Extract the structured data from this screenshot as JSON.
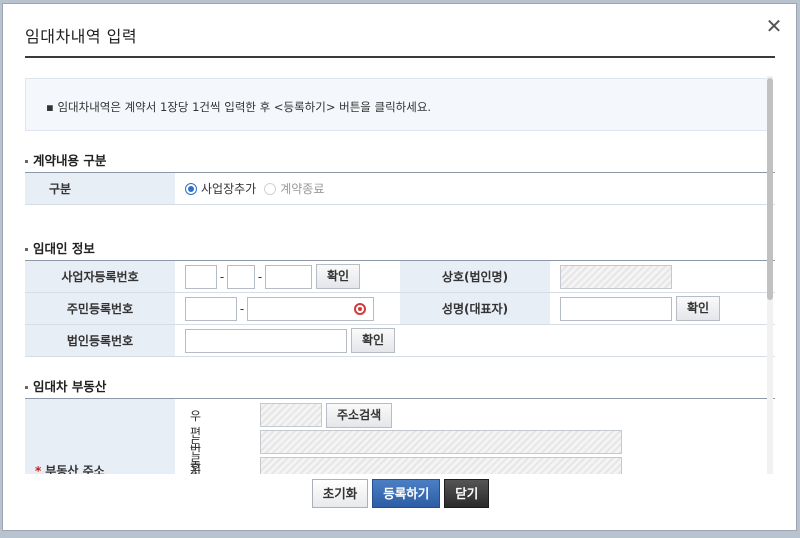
{
  "dialog": {
    "title": "임대차내역 입력",
    "close_icon": "close-icon"
  },
  "notice": {
    "text": "▪ 임대차내역은 계약서 1장당 1건씩 입력한 후 <등록하기> 버튼을 클릭하세요."
  },
  "section_contract": {
    "title": "계약내용 구분",
    "row_label": "구분",
    "options": [
      {
        "label": "사업장추가",
        "selected": true,
        "enabled": true
      },
      {
        "label": "계약종료",
        "selected": false,
        "enabled": false
      }
    ]
  },
  "section_lessor": {
    "title": "임대인 정보",
    "biz_reg_label": "사업자등록번호",
    "biz_confirm": "확인",
    "trade_name_label": "상호(법인명)",
    "resident_label": "주민등록번호",
    "name_label": "성명(대표자)",
    "name_confirm": "확인",
    "corp_reg_label": "법인등록번호",
    "corp_confirm": "확인"
  },
  "section_property": {
    "title": "임대차 부동산",
    "address_label": "부동산 주소",
    "postcode_label": "우편번호",
    "address_search": "주소검색",
    "road_address_label": "도로명주소",
    "lot_address_label": "지번주소"
  },
  "footer": {
    "reset": "초기화",
    "register": "등록하기",
    "close": "닫기"
  },
  "colors": {
    "label_bg": "#e8eef6",
    "primary": "#2d5ea5",
    "required": "#c81e1e"
  }
}
